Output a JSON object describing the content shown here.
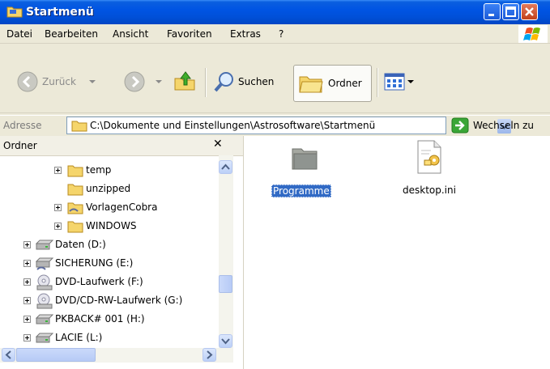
{
  "window": {
    "title": "Startmenü"
  },
  "menu": [
    "Datei",
    "Bearbeiten",
    "Ansicht",
    "Favoriten",
    "Extras",
    "?"
  ],
  "toolbar": {
    "back_label": "Zurück",
    "search_label": "Suchen",
    "folders_label": "Ordner"
  },
  "address": {
    "label": "Adresse",
    "value": "C:\\Dokumente und Einstellungen\\Astrosoftware\\Startmenü",
    "go_label": "Wechseln zu"
  },
  "folder_pane": {
    "title": "Ordner",
    "items": [
      {
        "label": "temp",
        "icon": "folder-icon",
        "expandable": true
      },
      {
        "label": "unzipped",
        "icon": "folder-icon",
        "expandable": false
      },
      {
        "label": "VorlagenCobra",
        "icon": "shared-folder-icon",
        "expandable": true
      },
      {
        "label": "WINDOWS",
        "icon": "folder-icon",
        "expandable": true
      },
      {
        "label": "Daten (D:)",
        "icon": "drive-icon",
        "expandable": true
      },
      {
        "label": "SICHERUNG (E:)",
        "icon": "shared-drive-icon",
        "expandable": true
      },
      {
        "label": "DVD-Laufwerk (F:)",
        "icon": "dvd-drive-icon",
        "expandable": true
      },
      {
        "label": "DVD/CD-RW-Laufwerk (G:)",
        "icon": "dvd-drive-icon",
        "expandable": true
      },
      {
        "label": "PKBACK# 001 (H:)",
        "icon": "drive-icon",
        "expandable": true
      },
      {
        "label": "LACIE (L:)",
        "icon": "drive-icon",
        "expandable": true
      }
    ]
  },
  "content": {
    "items": [
      {
        "label": "Programme",
        "icon": "folder-icon",
        "selected": true
      },
      {
        "label": "desktop.ini",
        "icon": "settings-file-icon",
        "selected": false
      }
    ]
  }
}
